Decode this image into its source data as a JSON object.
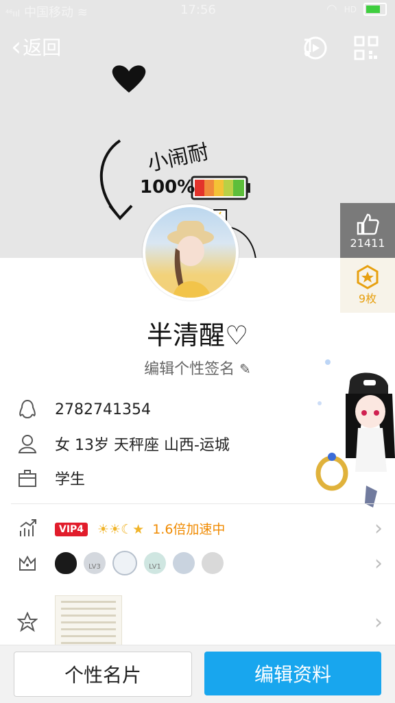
{
  "status_bar": {
    "carrier": "中国移动",
    "time": "17:56",
    "network": "HD"
  },
  "header": {
    "back_label": "返回"
  },
  "cover_art": {
    "text_top": "小闹耐",
    "percent": "100%"
  },
  "likes": {
    "count": "21411"
  },
  "badges": {
    "count_label": "9枚"
  },
  "profile": {
    "nickname": "半清醒♡",
    "signature_prompt": "编辑个性签名"
  },
  "info": {
    "qq_number": "2782741354",
    "personal": "女  13岁  天秤座  山西-运城",
    "occupation": "学生"
  },
  "vip": {
    "tag": "VIP4",
    "level_icons": "☀☀☾★",
    "speed_text": "1.6倍加速中"
  },
  "privileges": {
    "lv3": "LV3",
    "lv1": "LV1"
  },
  "buttons": {
    "card": "个性名片",
    "edit": "编辑资料"
  },
  "colors": {
    "accent": "#18a6ee",
    "vip_red": "#e11c2b",
    "speed_orange": "#f08a00"
  }
}
